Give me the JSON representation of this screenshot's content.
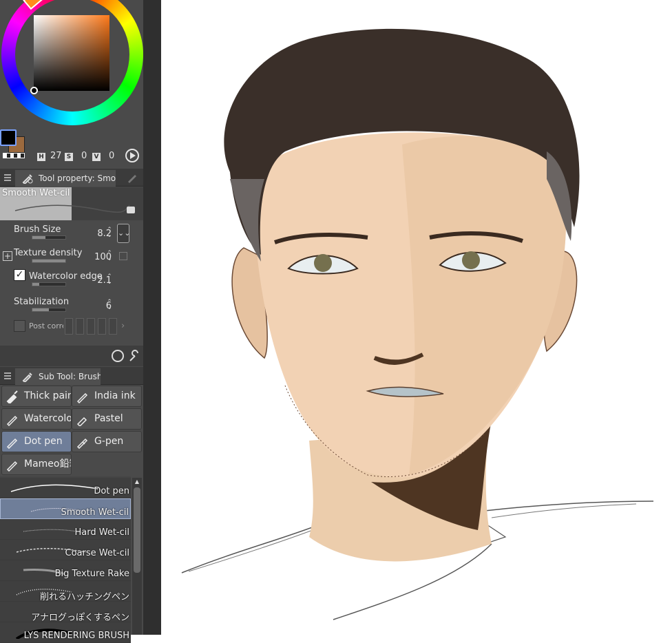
{
  "color": {
    "main_color": "#000000",
    "sub_color": "#9c6a3e",
    "hue_color": "#ff7a1a",
    "hsv": {
      "h_key": "H",
      "h_val": "27",
      "s_key": "S",
      "s_val": "0",
      "v_key": "V",
      "v_val": "0"
    }
  },
  "tool_property": {
    "tab_label": "Tool property: Smoo",
    "preset_name": "Smooth Wet-cil",
    "props": [
      {
        "label": "Brush Size",
        "value": "8.2",
        "fill": 0.4
      },
      {
        "label": "Texture density",
        "value": "100",
        "fill": 1.0
      },
      {
        "label": "Watercolor edge",
        "value": "2.1",
        "fill": 0.2
      },
      {
        "label": "Stabilization",
        "value": "6",
        "fill": 0.5
      },
      {
        "label": "Post corre",
        "value": ""
      }
    ]
  },
  "sub_tool": {
    "tab_label": "Sub Tool: Brush",
    "groups": [
      {
        "label": "Thick paint",
        "icon": "brush-icon"
      },
      {
        "label": "India ink",
        "icon": "pen-icon"
      },
      {
        "label": "Watercolor",
        "icon": "pen-icon"
      },
      {
        "label": "Pastel",
        "icon": "pastel-icon"
      },
      {
        "label": "Dot pen",
        "icon": "pen-icon"
      },
      {
        "label": "G-pen",
        "icon": "gpen-icon"
      },
      {
        "label": "Mameo鉛筆",
        "icon": "pen-icon"
      }
    ],
    "selected_group": "Dot pen",
    "brushes": [
      "Dot pen",
      "Smooth Wet-cil",
      "Hard Wet-cil",
      "Coarse Wet-cil",
      "Big Texture Rake",
      "削れるハッチングペン",
      "アナログっぽくするペン",
      "LYS RENDERING BRUSH"
    ],
    "selected_brush": "Smooth Wet-cil"
  },
  "canvas": {
    "skin": "#f2d2b4",
    "hair": "#3a2f29",
    "shadow": "#4e3522"
  }
}
